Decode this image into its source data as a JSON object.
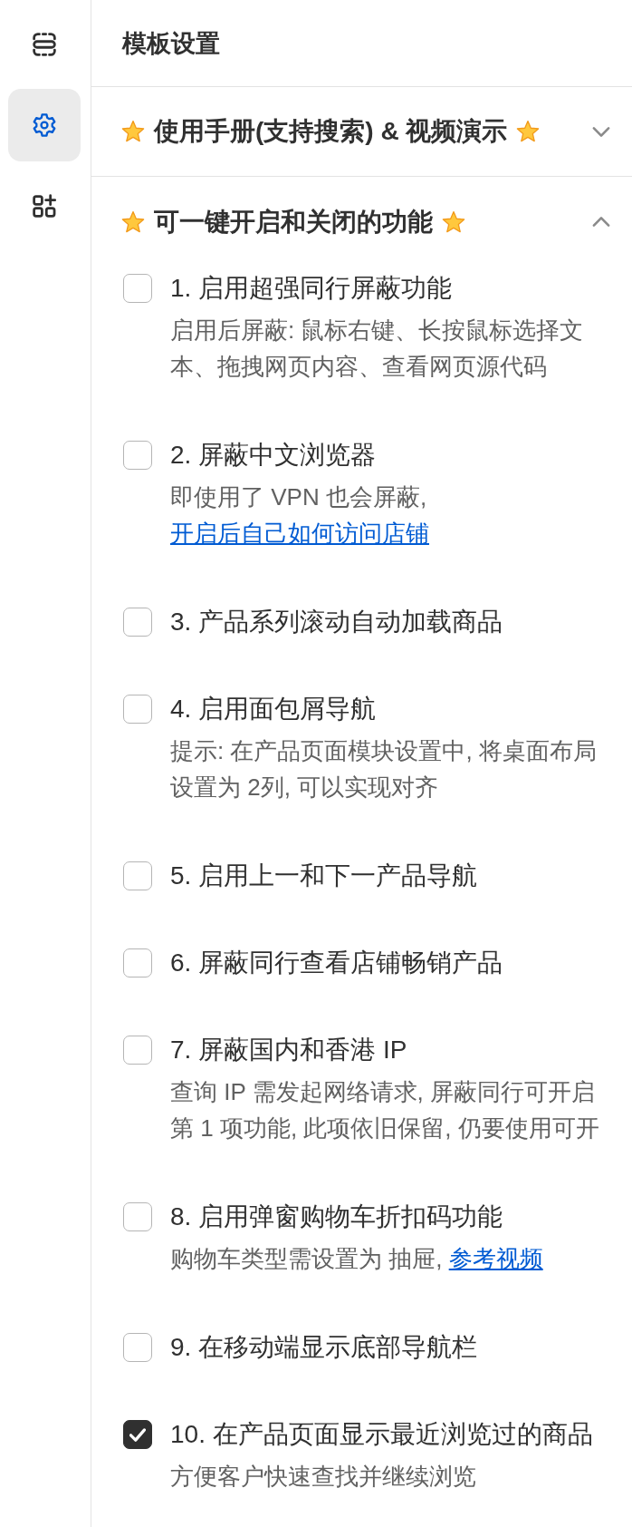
{
  "sidebar": {
    "items": [
      {
        "kind": "sections",
        "selected": false
      },
      {
        "kind": "settings",
        "selected": true
      },
      {
        "kind": "add-apps",
        "selected": false
      }
    ]
  },
  "header": {
    "title": "模板设置"
  },
  "sections": [
    {
      "title": "使用手册(支持搜索) & 视频演示",
      "expanded": false
    },
    {
      "title": "可一键开启和关闭的功能",
      "expanded": true,
      "options": [
        {
          "label": "1. 启用超强同行屏蔽功能",
          "checked": false,
          "description": "启用后屏蔽: 鼠标右键、长按鼠标选择文本、拖拽网页内容、查看网页源代码"
        },
        {
          "label": "2. 屏蔽中文浏览器",
          "checked": false,
          "description": "即使用了 VPN 也会屏蔽,",
          "link": "开启后自己如何访问店铺"
        },
        {
          "label": "3. 产品系列滚动自动加载商品",
          "checked": false
        },
        {
          "label": "4. 启用面包屑导航",
          "checked": false,
          "description": "提示: 在产品页面模块设置中, 将桌面布局设置为 2列, 可以实现对齐"
        },
        {
          "label": "5. 启用上一和下一产品导航",
          "checked": false
        },
        {
          "label": "6. 屏蔽同行查看店铺畅销产品",
          "checked": false
        },
        {
          "label": "7. 屏蔽国内和香港 IP",
          "checked": false,
          "description": "查询 IP 需发起网络请求, 屏蔽同行可开启第 1 项功能, 此项依旧保留, 仍要使用可开"
        },
        {
          "label": "8. 启用弹窗购物车折扣码功能",
          "checked": false,
          "description": "购物车类型需设置为 抽屉,",
          "link": "参考视频"
        },
        {
          "label": "9. 在移动端显示底部导航栏",
          "checked": false
        },
        {
          "label": "10. 在产品页面显示最近浏览过的商品",
          "checked": true,
          "description": "方便客户快速查找并继续浏览"
        }
      ]
    }
  ]
}
